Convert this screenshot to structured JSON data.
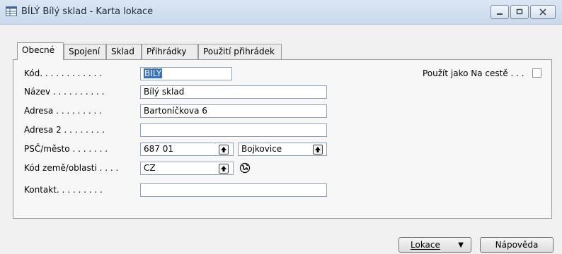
{
  "window": {
    "title": "BÍLÝ Bílý sklad - Karta lokace",
    "min_glyph": "—",
    "max_glyph": "▫",
    "close_glyph": "✕"
  },
  "tabs": [
    {
      "label": "Obecné",
      "active": true
    },
    {
      "label": "Spojení"
    },
    {
      "label": "Sklad"
    },
    {
      "label": "Přihrádky"
    },
    {
      "label": "Použití přihrádek"
    }
  ],
  "fields": {
    "kod": {
      "label": "Kód. . . . . . . . . . . .",
      "value": "BÍLÝ"
    },
    "nazev": {
      "label": "Název . . . . . . . . . .",
      "value": "Bílý sklad"
    },
    "adresa": {
      "label": "Adresa . . . . . . . . .",
      "value": "Bartoníčkova 6"
    },
    "adresa2": {
      "label": "Adresa 2 . . . . . . . .",
      "value": ""
    },
    "psc": {
      "label": "PSČ/město . . . . . . .",
      "value": "687 01",
      "city": "Bojkovice"
    },
    "zeme": {
      "label": "Kód země/oblasti . . . .",
      "value": "CZ"
    },
    "kontakt": {
      "label": "Kontakt. . . . . . . . .",
      "value": ""
    },
    "na_ceste": {
      "label": "Použít jako Na cestě . . .",
      "checked": false
    }
  },
  "buttons": {
    "lokace": "Lokace",
    "lokace_arrow": "▼",
    "napoveda": "Nápověda"
  },
  "icons": {
    "title": "table-icon",
    "lookup": "lookup-up-arrow-icon",
    "globe": "globe-icon"
  }
}
